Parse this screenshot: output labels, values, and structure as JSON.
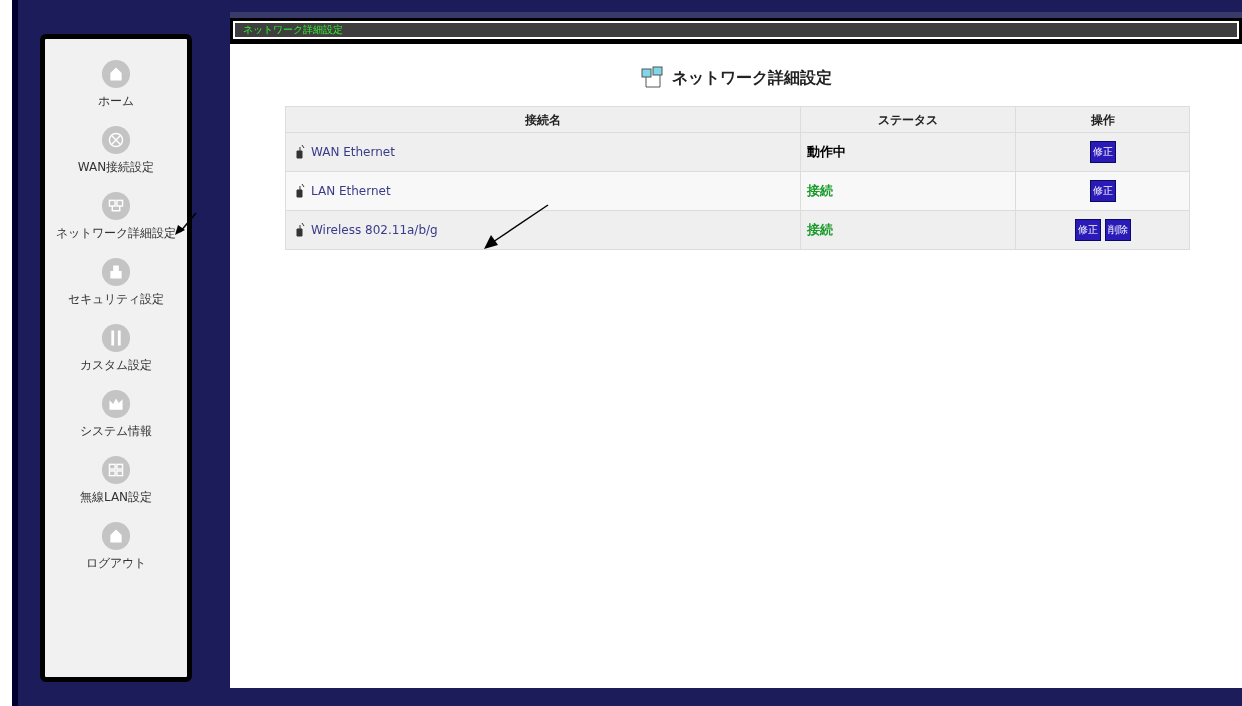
{
  "sidebar": {
    "items": [
      {
        "label": "ホーム",
        "kind": "home"
      },
      {
        "label": "WAN接続設定",
        "kind": "wan"
      },
      {
        "label": "ネットワーク詳細設定",
        "kind": "network"
      },
      {
        "label": "セキュリティ設定",
        "kind": "security"
      },
      {
        "label": "カスタム設定",
        "kind": "custom"
      },
      {
        "label": "システム情報",
        "kind": "system"
      },
      {
        "label": "無線LAN設定",
        "kind": "wireless"
      },
      {
        "label": "ログアウト",
        "kind": "logout"
      }
    ]
  },
  "panel": {
    "title": "ネットワーク詳細設定"
  },
  "page": {
    "heading": "ネットワーク詳細設定"
  },
  "table": {
    "columns": [
      "接続名",
      "ステータス",
      "操作"
    ],
    "rows": [
      {
        "name": "WAN Ethernet",
        "status": "動作中",
        "color": "#000000",
        "actions": [
          "修正"
        ]
      },
      {
        "name": "LAN Ethernet",
        "status": "接続",
        "color": "#1a9a2a",
        "actions": [
          "修正"
        ]
      },
      {
        "name": "Wireless 802.11a/b/g",
        "status": "接続",
        "color": "#1a9a2a",
        "actions": [
          "修正",
          "削除"
        ]
      }
    ]
  }
}
